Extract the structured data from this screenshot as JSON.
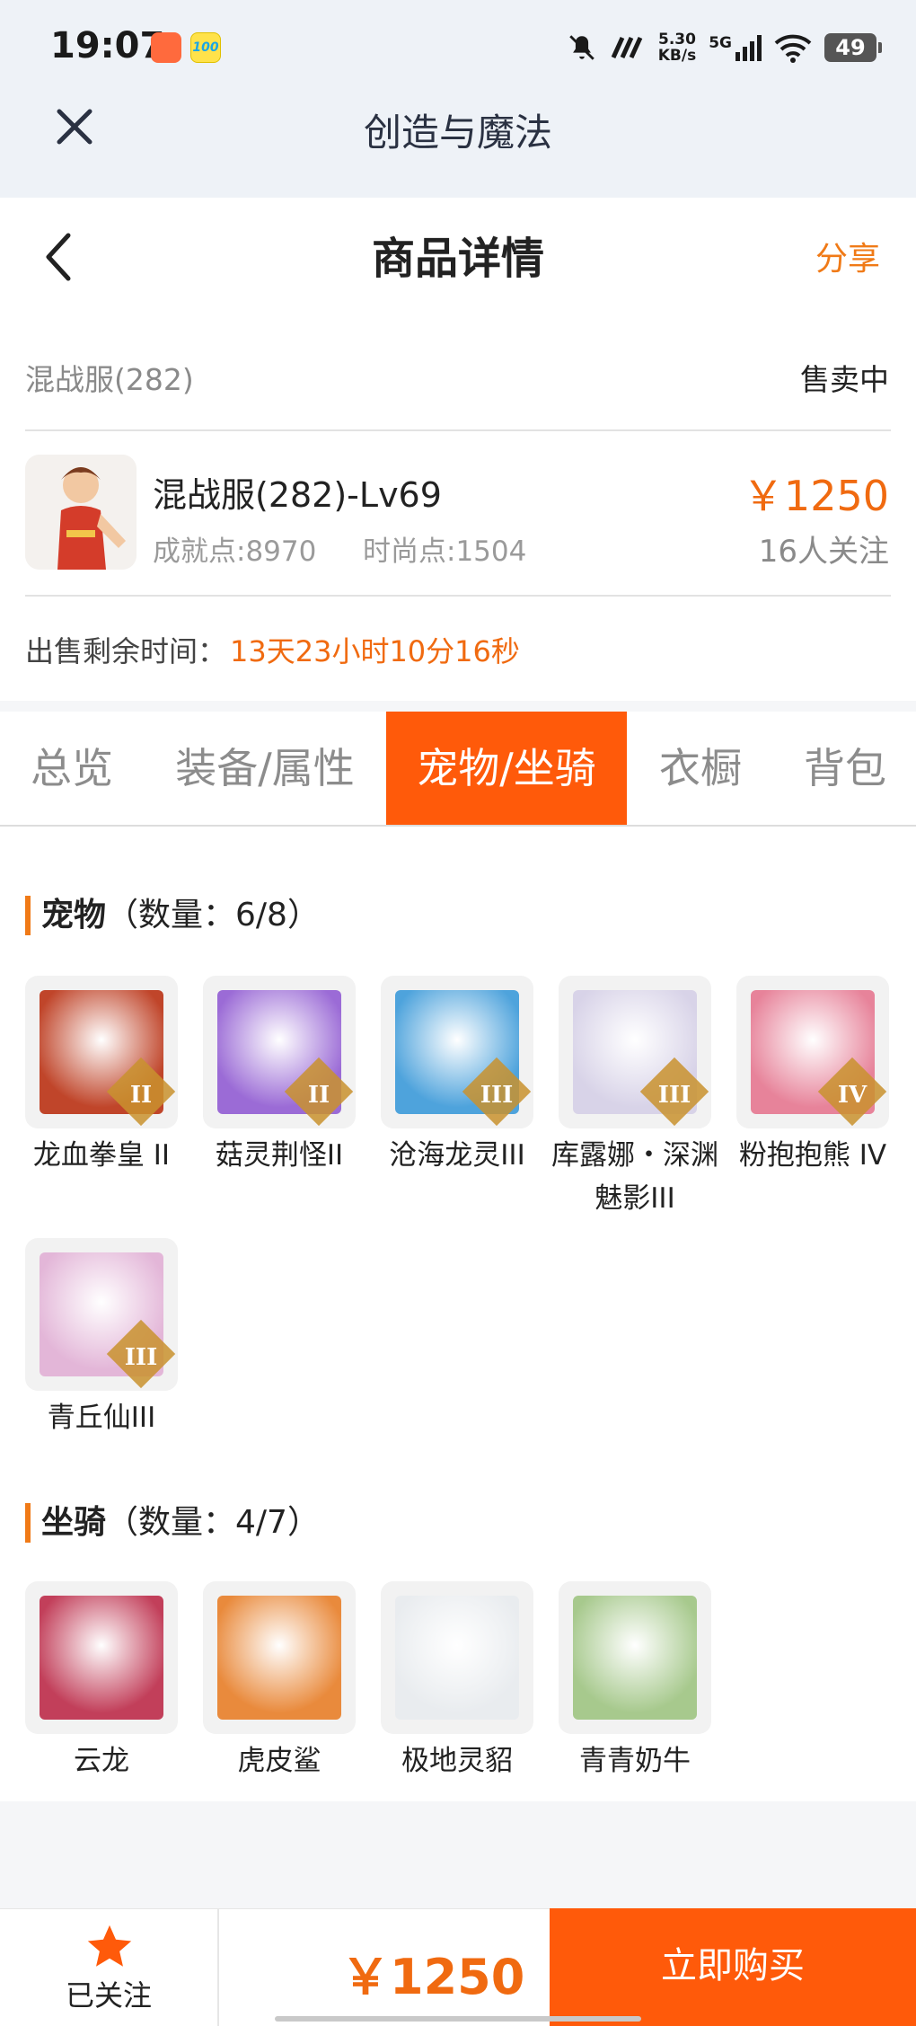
{
  "status_bar": {
    "time": "19:07",
    "app_badge_2": "100",
    "net_speed_value": "5.30",
    "net_speed_unit": "KB/s",
    "network": "5G",
    "battery": "49"
  },
  "titlebar": {
    "title": "创造与魔法"
  },
  "header": {
    "title": "商品详情",
    "share": "分享"
  },
  "info": {
    "server": "混战服(282)",
    "sale_status": "售卖中",
    "item_name": "混战服(282)-Lv69",
    "achievement": "成就点:8970",
    "fashion": "时尚点:1504",
    "price": "￥1250",
    "followers": "16人关注",
    "remaining_label": "出售剩余时间：",
    "remaining_value": "13天23小时10分16秒"
  },
  "tabs": [
    {
      "label": "总览",
      "active": false
    },
    {
      "label": "装备/属性",
      "active": false
    },
    {
      "label": "宠物/坐骑",
      "active": true
    },
    {
      "label": "衣橱",
      "active": false
    },
    {
      "label": "背包",
      "active": false
    }
  ],
  "pets": {
    "title": "宠物",
    "count": "（数量：6/8）",
    "items": [
      {
        "name": "龙血拳皇 II",
        "rank": "II",
        "color": "#c0452a"
      },
      {
        "name": "菇灵荆怪II",
        "rank": "II",
        "color": "#9b6bd6"
      },
      {
        "name": "沧海龙灵III",
        "rank": "III",
        "color": "#4ea3dc"
      },
      {
        "name": "库露娜・深渊魅影III",
        "rank": "III",
        "color": "#d8d3e8"
      },
      {
        "name": "粉抱抱熊 IV",
        "rank": "IV",
        "color": "#e7839a"
      },
      {
        "name": "青丘仙III",
        "rank": "III",
        "color": "#e3b6d8"
      }
    ]
  },
  "mounts": {
    "title": "坐骑",
    "count": "（数量：4/7）",
    "items": [
      {
        "name": "云龙",
        "color": "#c23f5a"
      },
      {
        "name": "虎皮鲨",
        "color": "#e98a3c"
      },
      {
        "name": "极地灵貂",
        "color": "#e9ecef"
      },
      {
        "name": "青青奶牛",
        "color": "#a7c98d"
      }
    ]
  },
  "bottom": {
    "followed_label": "已关注",
    "price": "￥1250",
    "buy_label": "立即购买"
  }
}
